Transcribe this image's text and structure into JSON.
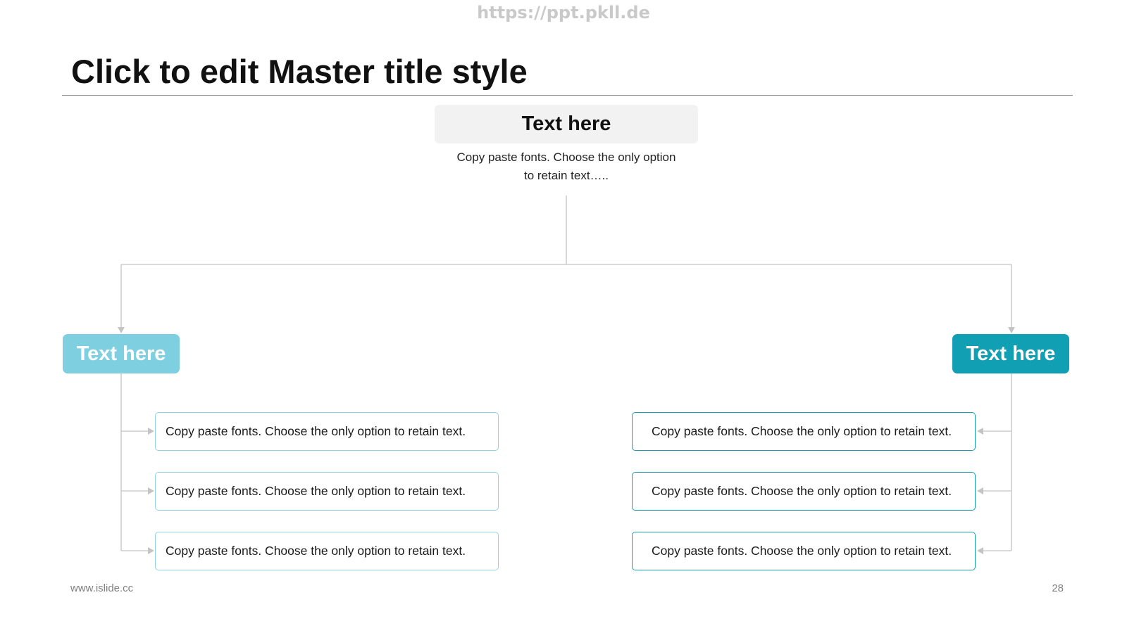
{
  "watermark": "https://ppt.pkll.de",
  "title": "Click to edit Master title style",
  "top_node": {
    "label": "Text here",
    "description_line1": "Copy paste fonts. Choose the only option",
    "description_line2": "to retain text….."
  },
  "left_branch": {
    "label": "Text here",
    "color": "#7ecfe0",
    "border_color": "#8fd4e4",
    "items": [
      "Copy paste fonts. Choose the only option to retain text.",
      "Copy paste fonts. Choose the only option to retain text.",
      "Copy paste fonts. Choose the only option to retain text."
    ]
  },
  "right_branch": {
    "label": "Text here",
    "color": "#109fb3",
    "border_color": "#1a9fb2",
    "items": [
      "Copy paste fonts. Choose the only option to retain text.",
      "Copy paste fonts. Choose the only option to retain text.",
      "Copy paste fonts. Choose the only option to retain text."
    ]
  },
  "footer": {
    "website": "www.islide.cc",
    "page_number": "28"
  },
  "colors": {
    "connector": "#c4c4c4",
    "top_box_bg": "#f2f2f2",
    "title_rule": "#8c8c8c"
  }
}
